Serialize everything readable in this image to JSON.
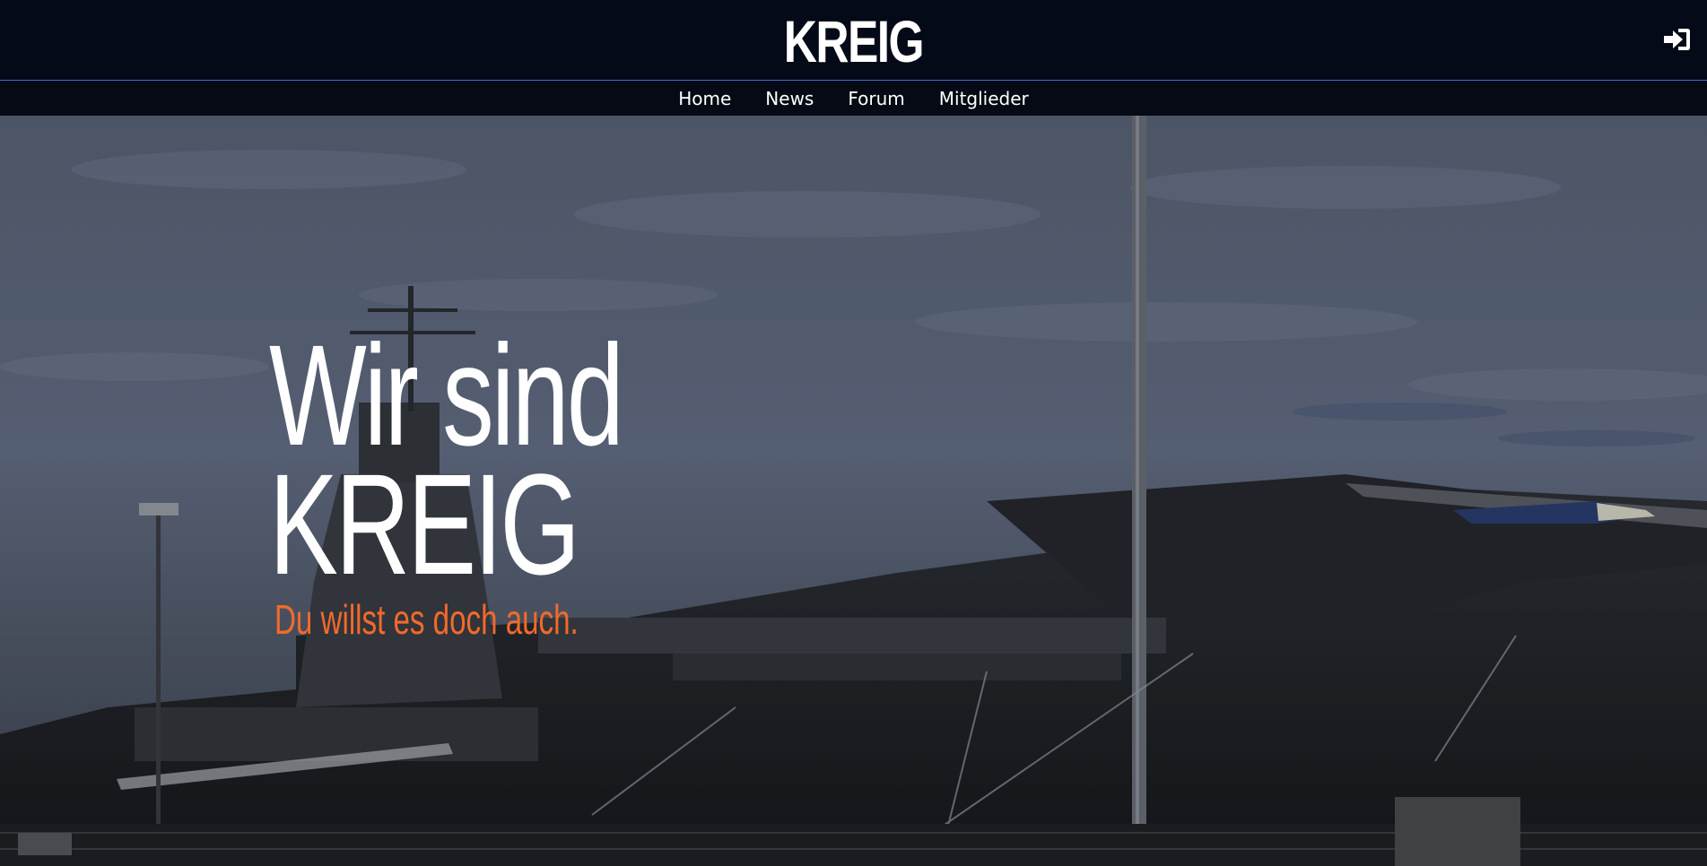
{
  "header": {
    "brand": "KREIG",
    "login_icon": "sign-in-icon"
  },
  "nav": {
    "items": [
      {
        "label": "Home"
      },
      {
        "label": "News"
      },
      {
        "label": "Forum"
      },
      {
        "label": "Mitglieder"
      }
    ]
  },
  "hero": {
    "title_line1": "Wir sind",
    "title_line2": "KREIG",
    "subtitle": "Du willst es doch auch.",
    "background": "aircraft-carrier-photo"
  },
  "colors": {
    "header_bg": "#040a17",
    "divider": "#3d6fd1",
    "accent": "#f26a2a",
    "text": "#ffffff"
  }
}
